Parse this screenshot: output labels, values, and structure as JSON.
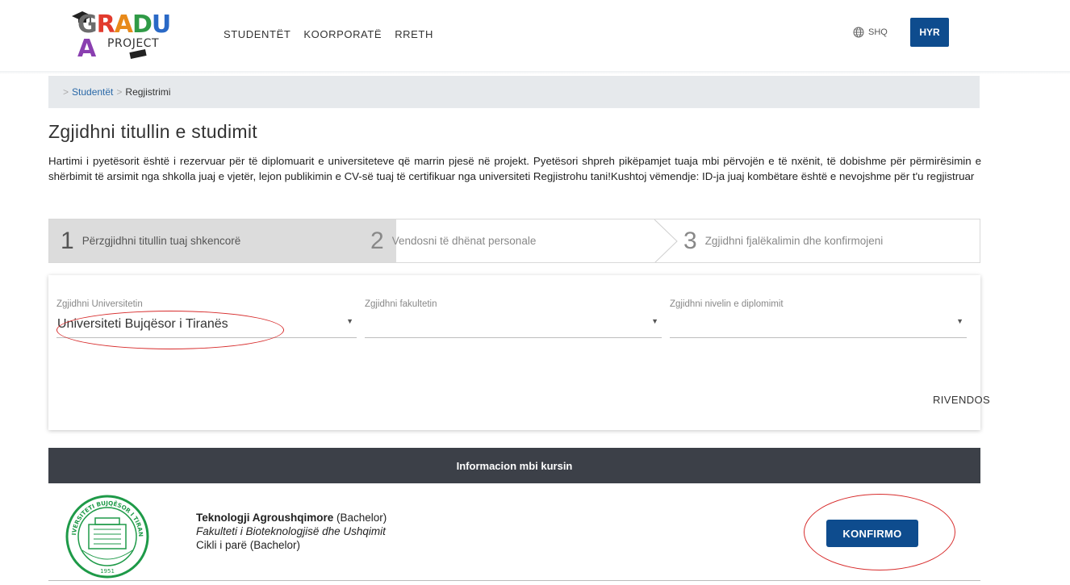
{
  "header": {
    "logo_word": "GRADUA",
    "logo_sub": "PROJECT",
    "nav": [
      "STUDENTËT",
      "KOORPORATË",
      "RRETH"
    ],
    "lang": "SHQ",
    "login_label": "HYR"
  },
  "breadcrumb": {
    "items": [
      "Studentët",
      "Regjistrimi"
    ]
  },
  "page": {
    "title": "Zgjidhni titullin e studimit",
    "intro": "Hartimi i pyetësorit është i rezervuar për të diplomuarit e universiteteve që marrin pjesë në projekt. Pyetësori shpreh pikëpamjet tuaja mbi përvojën e të nxënit, të dobishme për përmirësimin e shërbimit të arsimit nga shkolla juaj e vjetër, lejon publikimin e CV-së tuaj të certifikuar nga universiteti Regjistrohu tani!Kushtoj vëmendje: ID-ja juaj kombëtare është e nevojshme për t'u regjistruar"
  },
  "stepper": {
    "steps": [
      {
        "num": "1",
        "label": "Përzgjidhni titullin tuaj shkencorë"
      },
      {
        "num": "2",
        "label": "Vendosni të dhënat personale"
      },
      {
        "num": "3",
        "label": "Zgjidhni fjalëkalimin dhe konfirmojeni"
      }
    ]
  },
  "form": {
    "university_label": "Zgjidhni Universitetin",
    "university_value": "Universiteti Bujqësor i Tiranës",
    "faculty_label": "Zgjidhni fakultetin",
    "faculty_value": "",
    "level_label": "Zgjidhni nivelin e diplomimit",
    "level_value": "",
    "reset_label": "RIVENDOS"
  },
  "course_info": {
    "header": "Informacion mbi kursin",
    "name": "Teknologji Agroushqimore",
    "degree": " (Bachelor)",
    "faculty": "Fakulteti i Bioteknologjisë dhe Ushqimit",
    "cycle": "Cikli i parë (Bachelor)",
    "confirm_label": "KONFIRMO",
    "seal_text": "UNIVERSITETI BUJQËSOR I TIRANËS",
    "seal_year": "1951"
  },
  "colors": {
    "primary": "#0e4c8e",
    "header_dark": "#3c4048",
    "seal_green": "#1e9a48",
    "annotation_red": "#d72b2b"
  }
}
